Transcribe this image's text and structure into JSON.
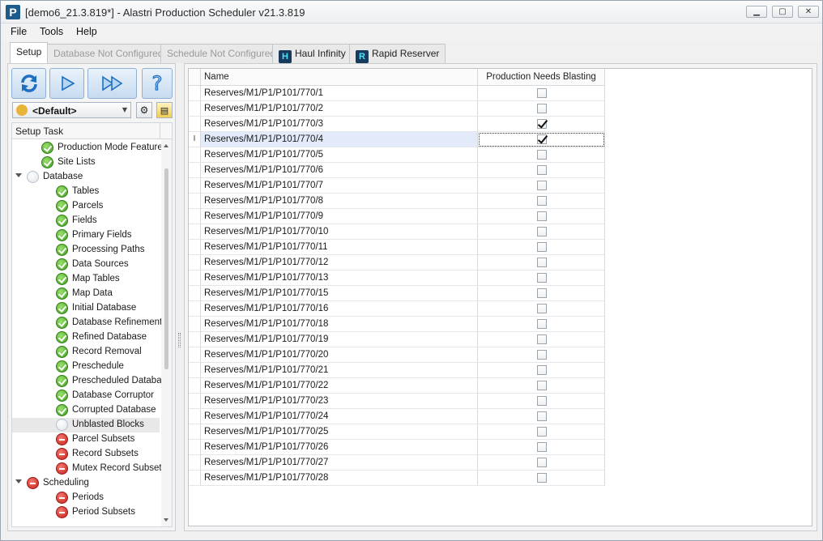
{
  "window": {
    "title": "[demo6_21.3.819*] - Alastri Production Scheduler v21.3.819",
    "logo_letter": "P",
    "minimize": "▁",
    "maximize": "▢",
    "close": "✕"
  },
  "menu": {
    "items": [
      "File",
      "Tools",
      "Help"
    ]
  },
  "tabs": [
    {
      "label": "Setup",
      "state": "active"
    },
    {
      "label": "Database Not Configured",
      "state": "disabled"
    },
    {
      "label": "Schedule Not Configured",
      "state": "disabled"
    },
    {
      "label": "Haul Infinity",
      "state": "normal",
      "icon": "haul-infinity-icon"
    },
    {
      "label": "Rapid Reserver",
      "state": "normal",
      "icon": "rapid-reserver-icon"
    }
  ],
  "left_panel": {
    "toolbar": [
      {
        "name": "refresh-button",
        "icon": "refresh-icon"
      },
      {
        "name": "run-button",
        "icon": "play-icon"
      },
      {
        "name": "run-all-button",
        "icon": "fast-forward-icon"
      },
      {
        "name": "help-button",
        "icon": "help-icon"
      }
    ],
    "profile": {
      "value": "<Default>"
    },
    "tree_header": "Setup Task",
    "tree": [
      {
        "label": "Production Mode Features",
        "status": "ok",
        "level": 1
      },
      {
        "label": "Site Lists",
        "status": "ok",
        "level": 1
      },
      {
        "label": "Database",
        "status": "none",
        "level": 0,
        "expanded": true
      },
      {
        "label": "Tables",
        "status": "ok",
        "level": 2
      },
      {
        "label": "Parcels",
        "status": "ok",
        "level": 2
      },
      {
        "label": "Fields",
        "status": "ok",
        "level": 2
      },
      {
        "label": "Primary Fields",
        "status": "ok",
        "level": 2
      },
      {
        "label": "Processing Paths",
        "status": "ok",
        "level": 2
      },
      {
        "label": "Data Sources",
        "status": "ok",
        "level": 2
      },
      {
        "label": "Map Tables",
        "status": "ok",
        "level": 2
      },
      {
        "label": "Map Data",
        "status": "ok",
        "level": 2
      },
      {
        "label": "Initial Database",
        "status": "ok",
        "level": 2
      },
      {
        "label": "Database Refinements",
        "status": "ok",
        "level": 2
      },
      {
        "label": "Refined Database",
        "status": "ok",
        "level": 2
      },
      {
        "label": "Record Removal",
        "status": "ok",
        "level": 2
      },
      {
        "label": "Preschedule",
        "status": "ok",
        "level": 2
      },
      {
        "label": "Prescheduled Database",
        "status": "ok",
        "level": 2
      },
      {
        "label": "Database Corruptor",
        "status": "ok",
        "level": 2
      },
      {
        "label": "Corrupted Database",
        "status": "ok",
        "level": 2
      },
      {
        "label": "Unblasted Blocks",
        "status": "none",
        "level": 2,
        "selected": true
      },
      {
        "label": "Parcel Subsets",
        "status": "err",
        "level": 2
      },
      {
        "label": "Record Subsets",
        "status": "err",
        "level": 2
      },
      {
        "label": "Mutex Record Subsets",
        "status": "err",
        "level": 2
      },
      {
        "label": "Scheduling",
        "status": "err",
        "level": 0,
        "expanded": true
      },
      {
        "label": "Periods",
        "status": "err",
        "level": 2
      },
      {
        "label": "Period Subsets",
        "status": "err",
        "level": 2
      }
    ]
  },
  "grid": {
    "columns": [
      "Name",
      "Production Needs Blasting"
    ],
    "focused_row_indicator": "I",
    "rows": [
      {
        "name": "Reserves/M1/P1/P101/770/1",
        "blast": false
      },
      {
        "name": "Reserves/M1/P1/P101/770/2",
        "blast": false
      },
      {
        "name": "Reserves/M1/P1/P101/770/3",
        "blast": true
      },
      {
        "name": "Reserves/M1/P1/P101/770/4",
        "blast": true,
        "focused": true
      },
      {
        "name": "Reserves/M1/P1/P101/770/5",
        "blast": false
      },
      {
        "name": "Reserves/M1/P1/P101/770/6",
        "blast": false
      },
      {
        "name": "Reserves/M1/P1/P101/770/7",
        "blast": false
      },
      {
        "name": "Reserves/M1/P1/P101/770/8",
        "blast": false
      },
      {
        "name": "Reserves/M1/P1/P101/770/9",
        "blast": false
      },
      {
        "name": "Reserves/M1/P1/P101/770/10",
        "blast": false
      },
      {
        "name": "Reserves/M1/P1/P101/770/11",
        "blast": false
      },
      {
        "name": "Reserves/M1/P1/P101/770/12",
        "blast": false
      },
      {
        "name": "Reserves/M1/P1/P101/770/13",
        "blast": false
      },
      {
        "name": "Reserves/M1/P1/P101/770/15",
        "blast": false
      },
      {
        "name": "Reserves/M1/P1/P101/770/16",
        "blast": false
      },
      {
        "name": "Reserves/M1/P1/P101/770/18",
        "blast": false
      },
      {
        "name": "Reserves/M1/P1/P101/770/19",
        "blast": false
      },
      {
        "name": "Reserves/M1/P1/P101/770/20",
        "blast": false
      },
      {
        "name": "Reserves/M1/P1/P101/770/21",
        "blast": false
      },
      {
        "name": "Reserves/M1/P1/P101/770/22",
        "blast": false
      },
      {
        "name": "Reserves/M1/P1/P101/770/23",
        "blast": false
      },
      {
        "name": "Reserves/M1/P1/P101/770/24",
        "blast": false
      },
      {
        "name": "Reserves/M1/P1/P101/770/25",
        "blast": false
      },
      {
        "name": "Reserves/M1/P1/P101/770/26",
        "blast": false
      },
      {
        "name": "Reserves/M1/P1/P101/770/27",
        "blast": false
      },
      {
        "name": "Reserves/M1/P1/P101/770/28",
        "blast": false
      }
    ]
  }
}
